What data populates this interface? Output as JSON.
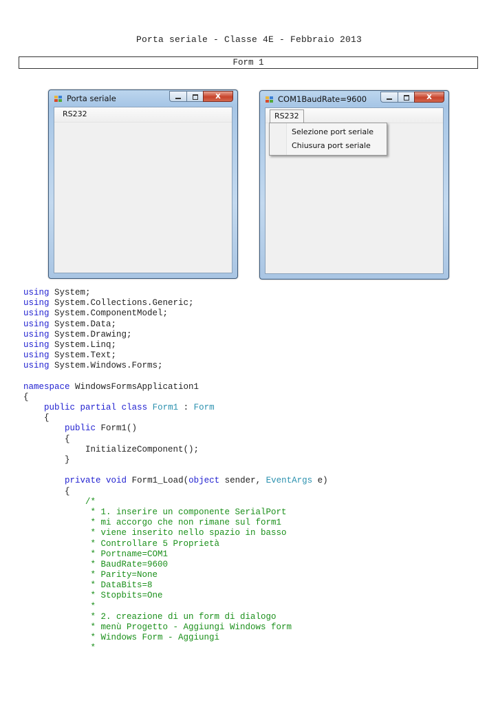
{
  "doc": {
    "title": "Porta seriale - Classe 4E - Febbraio 2013",
    "section": "Form 1"
  },
  "window1": {
    "title": "Porta seriale",
    "menu": "RS232",
    "close_glyph": "x"
  },
  "window2": {
    "title": "COM1BaudRate=9600",
    "menu": "RS232",
    "close_glyph": "x",
    "dropdown": [
      "Selezione port seriale",
      "Chiusura port seriale"
    ]
  },
  "code_lines": [
    [
      {
        "t": "using",
        "c": "kw"
      },
      {
        "t": " System;"
      }
    ],
    [
      {
        "t": "using",
        "c": "kw"
      },
      {
        "t": " System.Collections.Generic;"
      }
    ],
    [
      {
        "t": "using",
        "c": "kw"
      },
      {
        "t": " System.ComponentModel;"
      }
    ],
    [
      {
        "t": "using",
        "c": "kw"
      },
      {
        "t": " System.Data;"
      }
    ],
    [
      {
        "t": "using",
        "c": "kw"
      },
      {
        "t": " System.Drawing;"
      }
    ],
    [
      {
        "t": "using",
        "c": "kw"
      },
      {
        "t": " System.Linq;"
      }
    ],
    [
      {
        "t": "using",
        "c": "kw"
      },
      {
        "t": " System.Text;"
      }
    ],
    [
      {
        "t": "using",
        "c": "kw"
      },
      {
        "t": " System.Windows.Forms;"
      }
    ],
    [],
    [
      {
        "t": "namespace",
        "c": "kw"
      },
      {
        "t": " WindowsFormsApplication1"
      }
    ],
    [
      {
        "t": "{"
      }
    ],
    [
      {
        "t": "    "
      },
      {
        "t": "public",
        "c": "kw"
      },
      {
        "t": " "
      },
      {
        "t": "partial",
        "c": "kw"
      },
      {
        "t": " "
      },
      {
        "t": "class",
        "c": "kw"
      },
      {
        "t": " "
      },
      {
        "t": "Form1",
        "c": "ty"
      },
      {
        "t": " : "
      },
      {
        "t": "Form",
        "c": "ty"
      }
    ],
    [
      {
        "t": "    {"
      }
    ],
    [
      {
        "t": "        "
      },
      {
        "t": "public",
        "c": "kw"
      },
      {
        "t": " Form1()"
      }
    ],
    [
      {
        "t": "        {"
      }
    ],
    [
      {
        "t": "            InitializeComponent();"
      }
    ],
    [
      {
        "t": "        }"
      }
    ],
    [],
    [
      {
        "t": "        "
      },
      {
        "t": "private",
        "c": "kw"
      },
      {
        "t": " "
      },
      {
        "t": "void",
        "c": "kw"
      },
      {
        "t": " Form1_Load("
      },
      {
        "t": "object",
        "c": "kw"
      },
      {
        "t": " sender, "
      },
      {
        "t": "EventArgs",
        "c": "ty"
      },
      {
        "t": " e)"
      }
    ],
    [
      {
        "t": "        {"
      }
    ],
    [
      {
        "t": "            "
      },
      {
        "t": "/*",
        "c": "cm"
      }
    ],
    [
      {
        "t": "             * 1. inserire un componente SerialPort",
        "c": "cm"
      }
    ],
    [
      {
        "t": "             * mi accorgo che non rimane sul form1",
        "c": "cm"
      }
    ],
    [
      {
        "t": "             * viene inserito nello spazio in basso",
        "c": "cm"
      }
    ],
    [
      {
        "t": "             * Controllare 5 Proprietà",
        "c": "cm"
      }
    ],
    [
      {
        "t": "             * Portname=COM1",
        "c": "cm"
      }
    ],
    [
      {
        "t": "             * BaudRate=9600",
        "c": "cm"
      }
    ],
    [
      {
        "t": "             * Parity=None",
        "c": "cm"
      }
    ],
    [
      {
        "t": "             * DataBits=8",
        "c": "cm"
      }
    ],
    [
      {
        "t": "             * Stopbits=One",
        "c": "cm"
      }
    ],
    [
      {
        "t": "             *",
        "c": "cm"
      }
    ],
    [
      {
        "t": "             * 2. creazione di un form di dialogo",
        "c": "cm"
      }
    ],
    [
      {
        "t": "             * menù Progetto - Aggiungi Windows form",
        "c": "cm"
      }
    ],
    [
      {
        "t": "             * Windows Form - Aggiungi",
        "c": "cm"
      }
    ],
    [
      {
        "t": "             *",
        "c": "cm"
      }
    ]
  ]
}
